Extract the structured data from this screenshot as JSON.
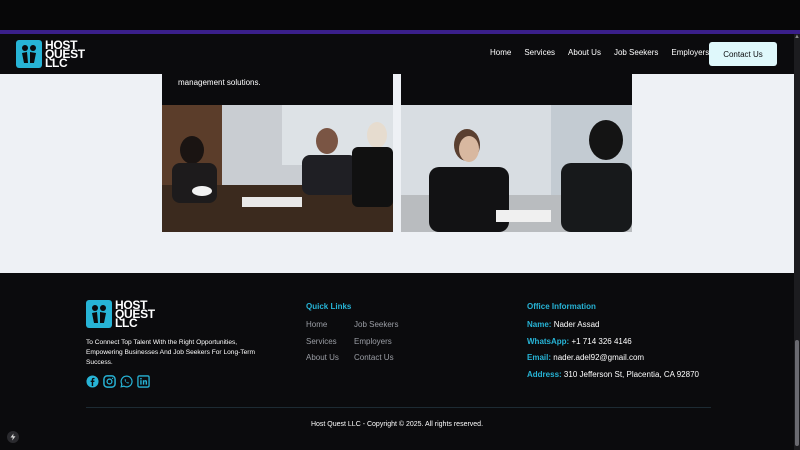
{
  "brand": {
    "line1": "HOST",
    "line2": "QUEST",
    "line3": "LLC"
  },
  "nav": {
    "links": [
      "Home",
      "Services",
      "About Us",
      "Job Seekers",
      "Employers"
    ],
    "cta_label": "Contact Us"
  },
  "cards": [
    {
      "text": "management solutions."
    },
    {
      "text": ""
    }
  ],
  "footer": {
    "tagline": "To Connect Top Talent With the Right Opportunities, Empowering Businesses And Job Seekers For Long-Term Success.",
    "quick_links_title": "Quick Links",
    "quick_links": [
      "Home",
      "Job Seekers",
      "Services",
      "Employers",
      "About Us",
      "Contact Us"
    ],
    "office_title": "Office Information",
    "name_label": "Name:",
    "name_value": "Nader Assad",
    "whatsapp_label": "WhatsApp:",
    "whatsapp_value": "+1 714 326 4146",
    "email_label": "Email:",
    "email_value": "nader.adel92@gmail.com",
    "address_label": "Address:",
    "address_value": "310 Jefferson St, Placentia, CA 92870",
    "copyright": "Host Quest LLC - Copyright © 2025. All rights reserved."
  },
  "social_icons": [
    "facebook-icon",
    "instagram-icon",
    "whatsapp-icon",
    "linkedin-icon"
  ],
  "colors": {
    "accent": "#27b4d6",
    "background": "#0b0b0d",
    "section_bg": "#eef1f5",
    "cta_bg": "#dff8fb"
  }
}
